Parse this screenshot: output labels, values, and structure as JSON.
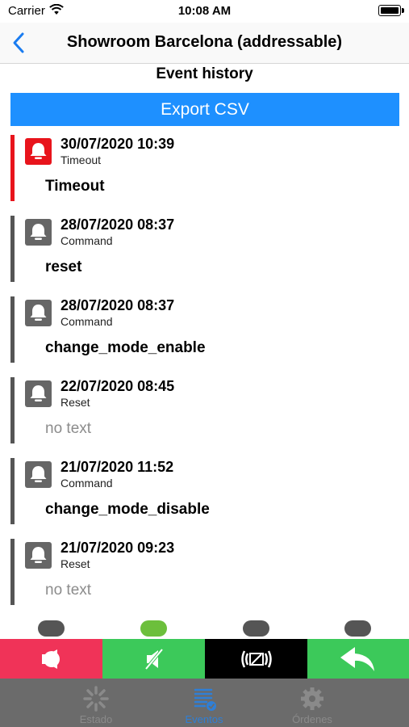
{
  "status": {
    "carrier": "Carrier",
    "time": "10:08 AM"
  },
  "nav": {
    "title": "Showroom Barcelona (addressable)"
  },
  "section_title": "Event history",
  "export_label": "Export CSV",
  "colors": {
    "alarm": "#e8141c",
    "normal": "#555555",
    "export": "#1e90ff",
    "green": "#3cc95a",
    "red": "#f03358",
    "tab_active": "#2f7fd6"
  },
  "events": [
    {
      "date": "30/07/2020 10:39",
      "type": "Timeout",
      "text": "Timeout",
      "alarm": true,
      "icon": "bell-icon"
    },
    {
      "date": "28/07/2020 08:37",
      "type": "Command",
      "text": "reset",
      "alarm": false,
      "icon": "bell-icon"
    },
    {
      "date": "28/07/2020 08:37",
      "type": "Command",
      "text": "change_mode_enable",
      "alarm": false,
      "icon": "bell-icon"
    },
    {
      "date": "22/07/2020 08:45",
      "type": "Reset",
      "text": "no text",
      "alarm": false,
      "icon": "bell-icon"
    },
    {
      "date": "21/07/2020 11:52",
      "type": "Command",
      "text": "change_mode_disable",
      "alarm": false,
      "icon": "bell-icon"
    },
    {
      "date": "21/07/2020 09:23",
      "type": "Reset",
      "text": "no text",
      "alarm": false,
      "icon": "bell-icon"
    }
  ],
  "actions": [
    {
      "name": "sounder-on-button",
      "icon": "sounder-icon"
    },
    {
      "name": "silence-button",
      "icon": "silence-icon"
    },
    {
      "name": "disable-device-button",
      "icon": "disabled-device-icon"
    },
    {
      "name": "reply-button",
      "icon": "reply-icon"
    }
  ],
  "tabs": [
    {
      "label": "Estado",
      "icon": "loading-icon",
      "active": false
    },
    {
      "label": "Eventos",
      "icon": "list-icon",
      "active": true
    },
    {
      "label": "Órdenes",
      "icon": "gear-icon",
      "active": false
    }
  ]
}
